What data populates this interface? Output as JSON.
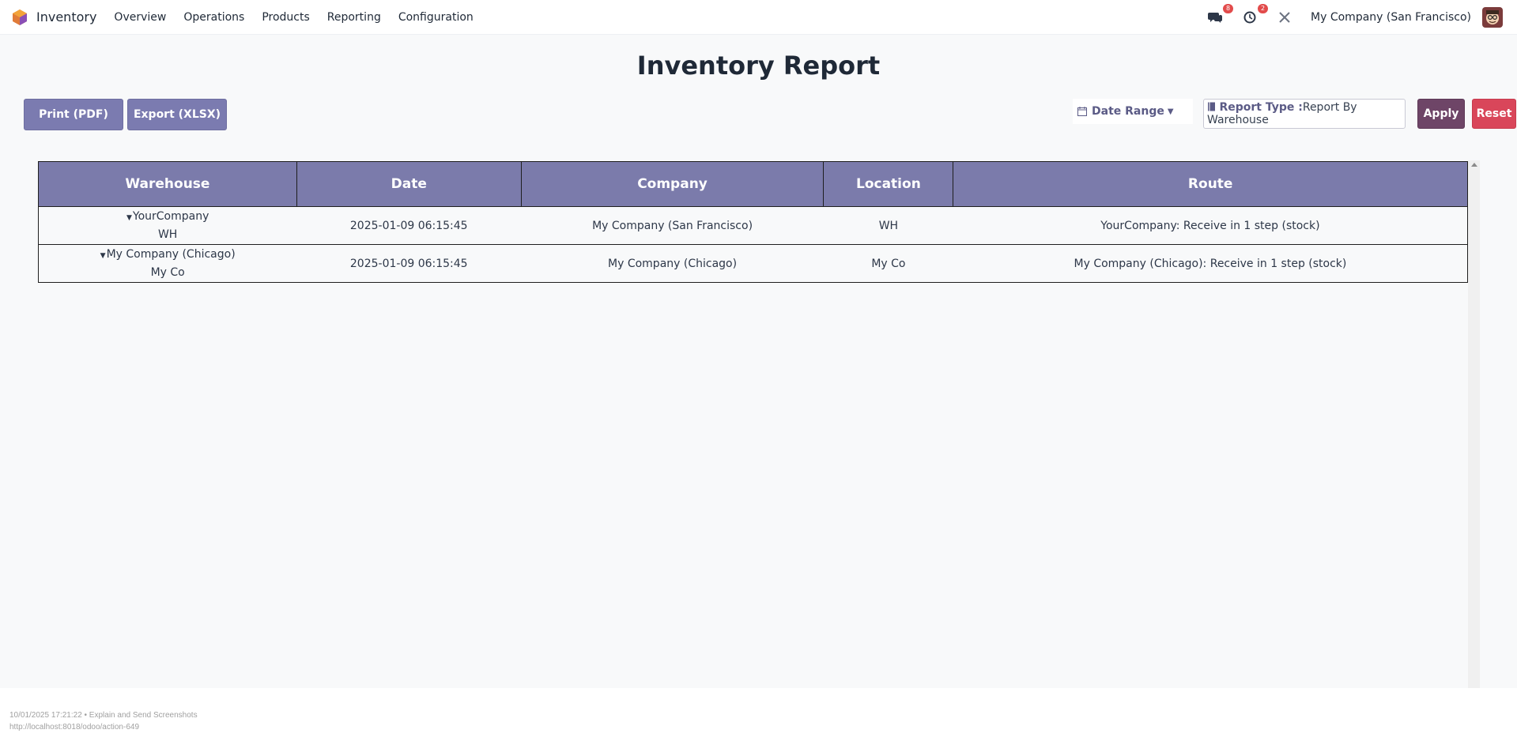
{
  "navbar": {
    "app_name": "Inventory",
    "menu": [
      "Overview",
      "Operations",
      "Products",
      "Reporting",
      "Configuration"
    ],
    "messages_badge": "8",
    "activities_badge": "2",
    "company": "My Company (San Francisco)"
  },
  "page": {
    "title": "Inventory Report"
  },
  "toolbar": {
    "print_label": "Print (PDF)",
    "export_label": "Export (XLSX)",
    "date_range_label": "Date Range",
    "report_type_label": "Report Type :",
    "report_type_value": "Report By Warehouse",
    "apply_label": "Apply",
    "reset_label": "Reset"
  },
  "table": {
    "headers": [
      "Warehouse",
      "Date",
      "Company",
      "Location",
      "Route"
    ],
    "rows": [
      {
        "warehouse": "YourCompany",
        "warehouse_code": "WH",
        "date": "2025-01-09 06:15:45",
        "company": "My Company (San Francisco)",
        "location": "WH",
        "route": "YourCompany: Receive in 1 step (stock)"
      },
      {
        "warehouse": "My Company (Chicago)",
        "warehouse_code": "My Co",
        "date": "2025-01-09 06:15:45",
        "company": "My Company (Chicago)",
        "location": "My Co",
        "route": "My Company (Chicago): Receive in 1 step (stock)"
      }
    ]
  },
  "footer": {
    "line1": "10/01/2025 17:21:22 • Explain and Send Screenshots",
    "line2": "http://localhost:8018/odoo/action-649"
  },
  "colors": {
    "header_bg": "#7b7bab",
    "button_bg": "#7b7bb0",
    "apply_bg": "#6e4567",
    "reset_bg": "#d9465a",
    "badge_bg": "#e24b4b"
  },
  "icons": [
    "odoo-logo-icon",
    "chat-icon",
    "clock-icon",
    "tools-icon",
    "calendar-icon",
    "book-icon",
    "caret-down-icon"
  ]
}
